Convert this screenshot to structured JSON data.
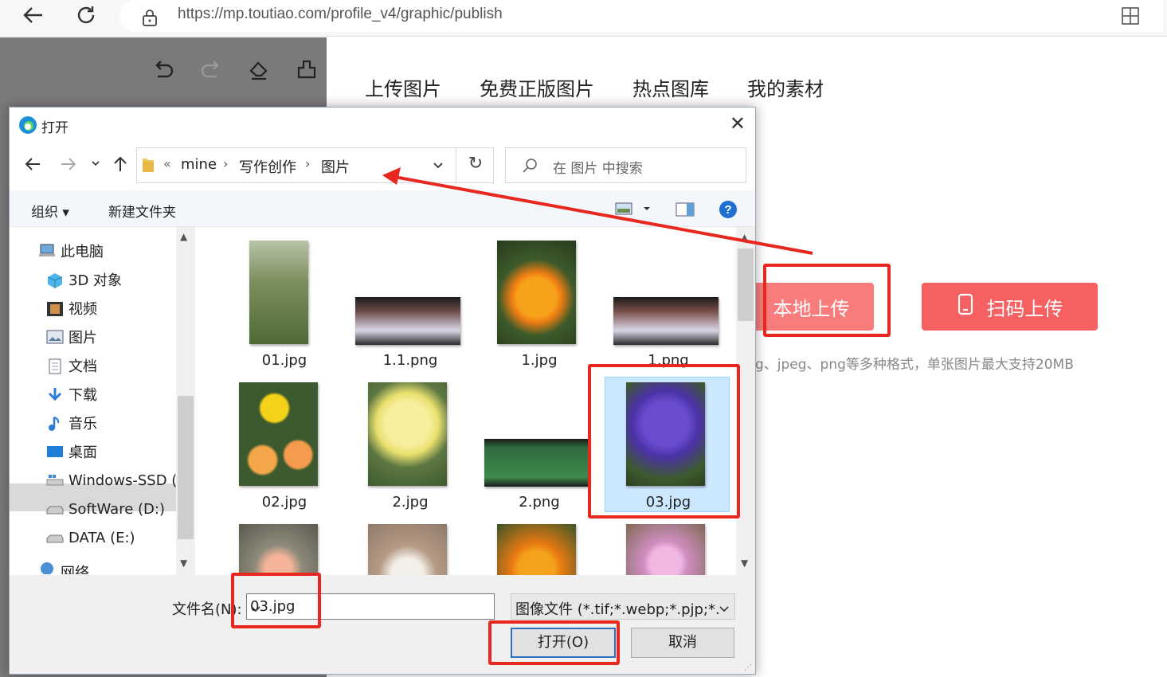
{
  "browser": {
    "url": "https://mp.toutiao.com/profile_v4/graphic/publish"
  },
  "page": {
    "tabs": [
      "上传图片",
      "免费正版图片",
      "热点图库",
      "我的素材"
    ],
    "local_upload_label": "本地上传",
    "scan_upload_label": "扫码上传",
    "hint": "g、jpeg、png等多种格式，单张图片最大支持20MB"
  },
  "dialog": {
    "title": "打开",
    "breadcrumb": [
      "mine",
      "写作创作",
      "图片"
    ],
    "breadcrumb_prefix": "«",
    "search_placeholder": "在 图片 中搜索",
    "organize_label": "组织 ▾",
    "new_folder_label": "新建文件夹",
    "nav_items": [
      {
        "label": "此电脑",
        "icon": "computer-icon"
      },
      {
        "label": "3D 对象",
        "icon": "cube-icon"
      },
      {
        "label": "视频",
        "icon": "video-icon"
      },
      {
        "label": "图片",
        "icon": "pictures-icon"
      },
      {
        "label": "文档",
        "icon": "document-icon"
      },
      {
        "label": "下载",
        "icon": "download-icon"
      },
      {
        "label": "音乐",
        "icon": "music-icon"
      },
      {
        "label": "桌面",
        "icon": "desktop-icon"
      },
      {
        "label": "Windows-SSD (",
        "icon": "drive-icon"
      },
      {
        "label": "SoftWare (D:)",
        "icon": "drive-icon"
      },
      {
        "label": "DATA (E:)",
        "icon": "drive-icon"
      },
      {
        "label": "网络",
        "icon": "network-icon"
      }
    ],
    "files": [
      {
        "name": "01.jpg"
      },
      {
        "name": "1.1.png"
      },
      {
        "name": "1.jpg"
      },
      {
        "name": "1.png"
      },
      {
        "name": "02.jpg"
      },
      {
        "name": "2.jpg"
      },
      {
        "name": "2.png"
      },
      {
        "name": "03.jpg"
      },
      {
        "name": ""
      },
      {
        "name": ""
      },
      {
        "name": ""
      },
      {
        "name": ""
      }
    ],
    "filename_label": "文件名(N):",
    "filename_value": "03.jpg",
    "filter_value": "图像文件 (*.tif;*.webp;*.pjp;*.a",
    "open_label": "打开(O)",
    "cancel_label": "取消"
  },
  "colors": {
    "annotation_red": "#e8271e",
    "upload_button": "#f66060",
    "selected_tile": "#cce8ff"
  }
}
